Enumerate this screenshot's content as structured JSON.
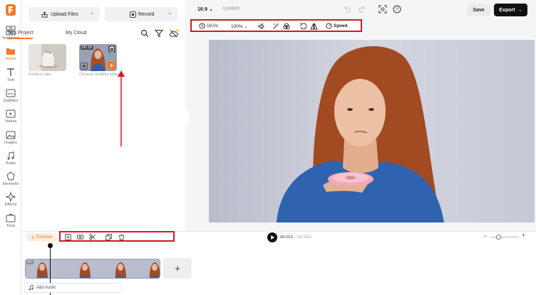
{
  "sidebar": {
    "items": [
      {
        "label": "Templates",
        "icon": "templates-icon"
      },
      {
        "label": "Media",
        "icon": "media-icon",
        "active": true
      },
      {
        "label": "Text",
        "icon": "text-icon"
      },
      {
        "label": "Subtitles",
        "icon": "subtitles-icon"
      },
      {
        "label": "Videos",
        "icon": "videos-icon"
      },
      {
        "label": "Images",
        "icon": "images-icon"
      },
      {
        "label": "Audio",
        "icon": "audio-icon"
      },
      {
        "label": "Elements",
        "icon": "elements-icon"
      },
      {
        "label": "Effects",
        "icon": "effects-icon"
      },
      {
        "label": "Tools",
        "icon": "tools-icon"
      }
    ]
  },
  "media": {
    "upload_label": "Upload Files",
    "record_label": "Record",
    "tabs": [
      "This Project",
      "My Cloud"
    ],
    "items": [
      {
        "caption": "fondant cake"
      },
      {
        "caption": "Closeup doubtful white",
        "duration": "00:18"
      }
    ]
  },
  "header": {
    "aspect": "16:9",
    "title": "Untitled",
    "save_label": "Save",
    "export_label": "Export"
  },
  "toolbar": {
    "duration": "18.0s",
    "zoom": "100%",
    "speed_label": "Speed"
  },
  "timeline": {
    "label": "Timeline",
    "current_time": "00:03.5",
    "total_time": "/ 00:18.0",
    "clip_index": "01",
    "add_audio_label": "Add Audio",
    "add_clip_symbol": "+"
  },
  "colors": {
    "accent": "#f07a2a",
    "highlight": "#d7172a",
    "dark": "#111111"
  }
}
